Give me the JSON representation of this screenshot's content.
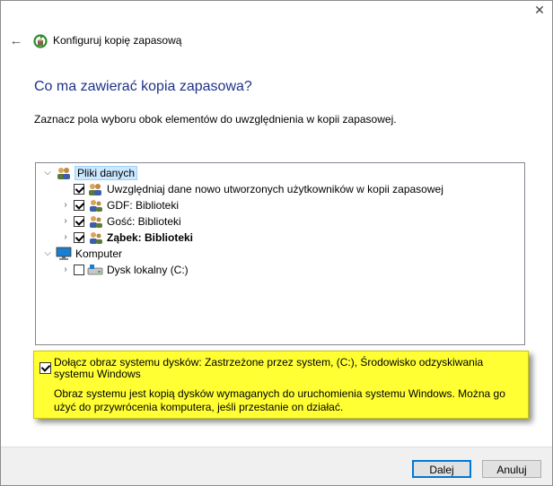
{
  "window": {
    "title": "Konfiguruj kopię zapasową",
    "close_glyph": "✕",
    "back_glyph": "←"
  },
  "page": {
    "heading": "Co ma zawierać kopia zapasowa?",
    "instruction": "Zaznacz pola wyboru obok elementów do uwzględnienia w kopii zapasowej."
  },
  "tree": {
    "data_files": {
      "label": "Pliki danych",
      "icon": "users-icon",
      "expanded": true
    },
    "include_new_users": {
      "label": "Uwzględniaj dane nowo utworzonych użytkowników w kopii zapasowej",
      "checked": true,
      "icon": "users-icon"
    },
    "gdf": {
      "label": "GDF: Biblioteki",
      "checked": true,
      "icon": "user-icon"
    },
    "guest": {
      "label": "Gość: Biblioteki",
      "checked": true,
      "icon": "user-icon"
    },
    "zabek": {
      "label": "Ząbek: Biblioteki",
      "checked": true,
      "icon": "user-icon"
    },
    "computer": {
      "label": "Komputer",
      "icon": "computer-icon",
      "expanded": true
    },
    "local_disk": {
      "label": "Dysk lokalny (C:)",
      "checked": false,
      "icon": "disk-icon"
    }
  },
  "system_image": {
    "label": "Dołącz obraz systemu dysków: Zastrzeżone przez system, (C:), Środowisko odzyskiwania systemu Windows",
    "checked": true,
    "description": "Obraz systemu jest kopią dysków wymaganych do uruchomienia systemu Windows. Można go użyć do przywrócenia komputera, jeśli przestanie on działać.",
    "highlight_color": "#ffff33"
  },
  "buttons": {
    "next": "Dalej",
    "cancel": "Anuluj"
  },
  "colors": {
    "heading": "#1e3287",
    "selection": "#cce8ff",
    "primary_border": "#0078d7"
  }
}
